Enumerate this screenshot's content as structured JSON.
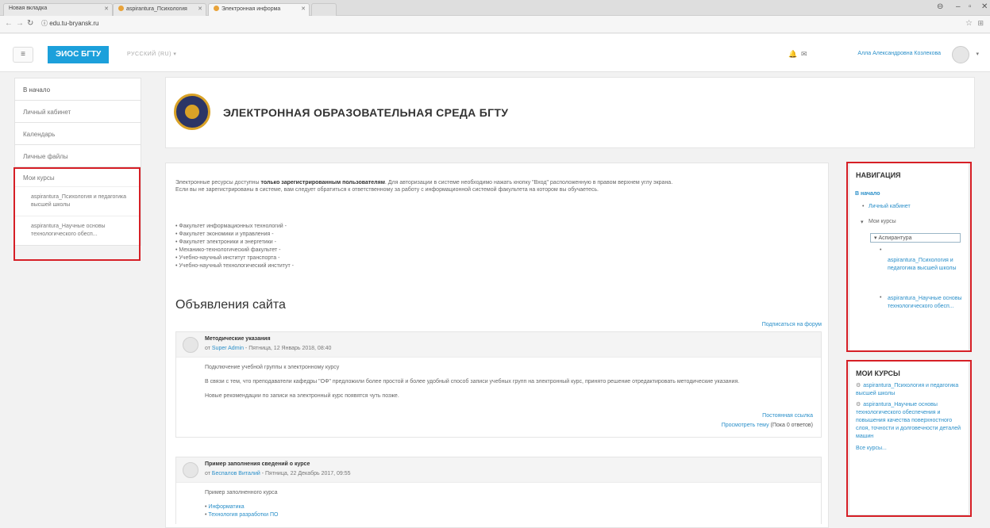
{
  "browser": {
    "tabs": [
      {
        "label": "Новая вкладка"
      },
      {
        "label": "aspirantura_Психология"
      },
      {
        "label": "Электронная информа"
      }
    ],
    "url": "edu.tu-bryansk.ru"
  },
  "header": {
    "brand": "ЭИОС БГТУ",
    "language": "РУССКИЙ (RU) ▾",
    "user": "Алла Александровна Козлекова"
  },
  "leftnav": {
    "items": [
      "В начало",
      "Личный кабинет",
      "Календарь",
      "Личные файлы"
    ],
    "mycourses_label": "Мои курсы",
    "courses": [
      "aspirantura_Психология и педагогика высшей школы",
      "aspirantura_Научные основы технологического обесп..."
    ]
  },
  "banner": {
    "title": "ЭЛЕКТРОННАЯ ОБРАЗОВАТЕЛЬНАЯ СРЕДА БГТУ"
  },
  "main": {
    "intro_prefix": "Электронные ресурсы доступны ",
    "intro_bold": "только зарегистрированным пользователям",
    "intro_suffix": ". Для авторизации в системе необходимо нажать кнопку \"Вход\" расположенную в правом верхнем углу экрана.",
    "intro_line2": "Если вы не зарегистрированы в системе, вам следует обратиться к ответственному за работу с информационной системой факультета на котором вы обучаетесь.",
    "faculties": [
      "Факультет информационных технологий -",
      "Факультет экономики и управления -",
      "Факультет электроники и энергетики -",
      "Механико-технологический факультет -",
      "Учебно-научный институт транспорта -",
      "Учебно-научный технологический институт -"
    ],
    "news_heading": "Объявления сайта",
    "subscribe": "Подписаться на форум",
    "posts": [
      {
        "title": "Методические указания",
        "by_prefix": "от ",
        "author": "Super Admin",
        "date": " - Пятница, 12 Январь 2018, 08:40",
        "paragraphs": [
          "Подключение учебной группы к электронному курсу",
          "В связи с тем, что преподаватели кафедры \"ОФ\" предложили более простой и более удобный способ записи учебных групп на электронный курс, принято решение отредактировать методические указания.",
          "Новые рекомендации по записи на электронный курс появятся чуть позже."
        ],
        "permalink": "Постоянная ссылка",
        "discuss": "Просмотреть тему",
        "replies": " (Пока 0 ответов)"
      },
      {
        "title": "Пример заполнения сведений о курсе",
        "by_prefix": "от ",
        "author": "Беспалов Виталий",
        "date": " - Пятница, 22 Декабрь 2017, 09:55",
        "paragraphs": [
          "Пример заполненного курса"
        ],
        "list": [
          "Информатика",
          "Технология разработки ПО"
        ]
      }
    ]
  },
  "navigation_block": {
    "title": "НАВИГАЦИЯ",
    "home": "В начало",
    "dashboard": "Личный кабинет",
    "mycourses": "Мои курсы",
    "category": "Аспирантура",
    "course1": "aspirantura_Психология и педагогика высшей школы",
    "course2": "aspirantura_Научные основы технологического обесп..."
  },
  "mycourses_block": {
    "title": "МОИ КУРСЫ",
    "courses": [
      "aspirantura_Психология и педагогика высшей школы",
      "aspirantura_Научные основы технологического обеспечения и повышения качества поверхностного слоя, точности и долговечности деталей машин"
    ],
    "all": "Все курсы..."
  },
  "highlight_color": "#d61f26",
  "accent_color": "#1ca0db"
}
